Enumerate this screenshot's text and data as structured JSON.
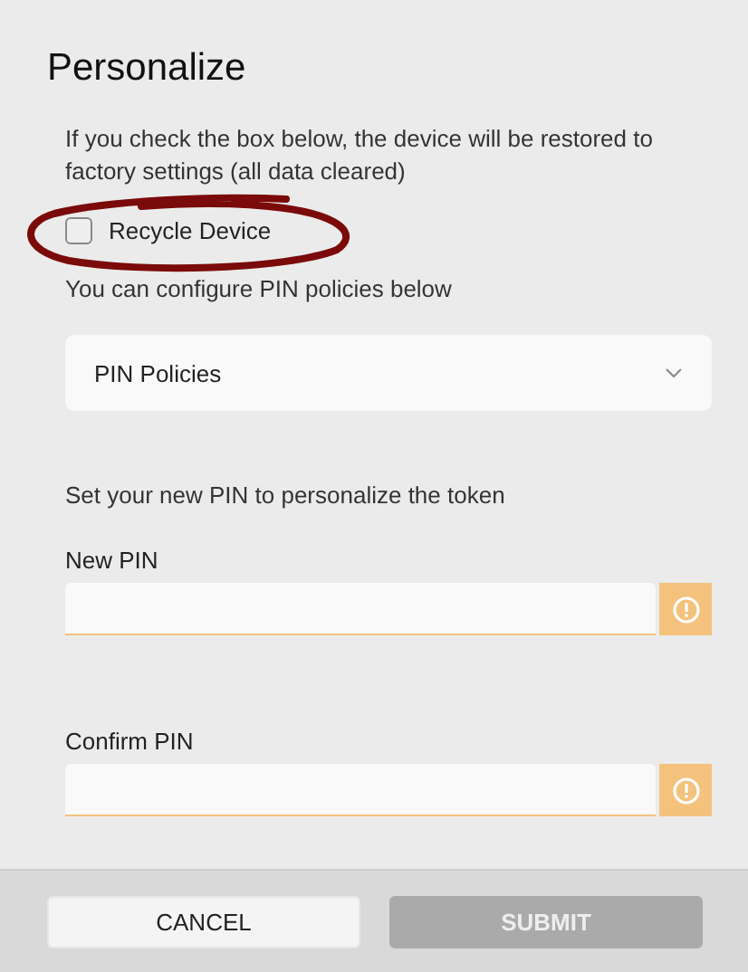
{
  "title": "Personalize",
  "intro": "If you check the box below, the device will be restored to factory settings (all data cleared)",
  "recycle": {
    "label": "Recycle Device",
    "checked": false
  },
  "annotation": {
    "kind": "ellipse",
    "color": "#7b0a0a"
  },
  "policy_hint": "You can configure PIN policies below",
  "policy_dropdown": {
    "value": "PIN Policies"
  },
  "pin_hint": "Set your new PIN to personalize the token",
  "fields": [
    {
      "label": "New PIN",
      "warning": true
    },
    {
      "label": "Confirm PIN",
      "warning": true
    }
  ],
  "buttons": [
    {
      "label": "CANCEL",
      "disabled": false
    },
    {
      "label": "SUBMIT",
      "disabled": true
    }
  ]
}
